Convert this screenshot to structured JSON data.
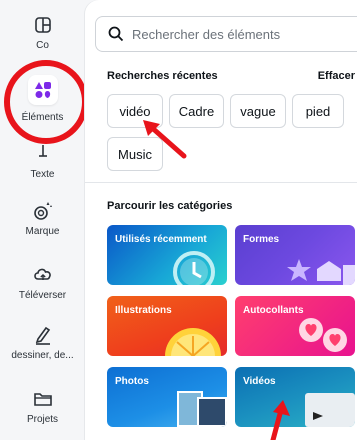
{
  "rail": {
    "items": [
      {
        "label": "Co",
        "icon": "layout-icon"
      },
      {
        "label": "Éléments",
        "icon": "elements-icon"
      },
      {
        "label": "Texte",
        "icon": "text-icon"
      },
      {
        "label": "Marque",
        "icon": "brand-icon"
      },
      {
        "label": "Téléverser",
        "icon": "cloud-upload-icon"
      },
      {
        "label": "dessiner, de...",
        "icon": "pen-icon"
      },
      {
        "label": "Projets",
        "icon": "folder-icon"
      }
    ]
  },
  "search": {
    "placeholder": "Rechercher des éléments"
  },
  "recent": {
    "title": "Recherches récentes",
    "clear_label": "Effacer",
    "chips": [
      "vidéo",
      "Cadre",
      "vague",
      "pied",
      "Music"
    ]
  },
  "browse": {
    "title": "Parcourir les catégories",
    "categories": [
      "Utilisés récemment",
      "Formes",
      "Illustrations",
      "Autocollants",
      "Photos",
      "Vidéos"
    ]
  },
  "colors": {
    "accent_red": "#e8141b",
    "elements_icon": "#7d2ae8"
  }
}
